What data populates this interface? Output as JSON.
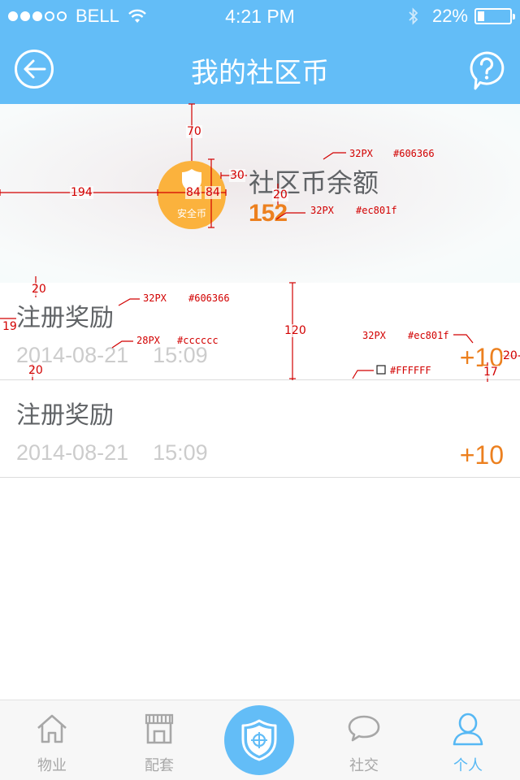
{
  "status_bar": {
    "carrier": "BELL",
    "time": "4:21 PM",
    "battery": "22%",
    "battery_level": 0.22,
    "signal_bars_filled": 3,
    "signal_bars_total": 5
  },
  "nav": {
    "title": "我的社区币",
    "back_icon": "back-arrow-icon",
    "help_icon": "question-bubble-icon"
  },
  "balance": {
    "coin_label": "安全币",
    "title": "社区币余额",
    "value": "152"
  },
  "records": [
    {
      "title": "注册奖励",
      "time": "2014-08-21    15:09",
      "amount": "+10"
    },
    {
      "title": "注册奖励",
      "time": "2014-08-21    15:09",
      "amount": "+10"
    }
  ],
  "annotations": {
    "coin_top": "70",
    "coin_left": "194",
    "coin_size_a": "84",
    "coin_size_b": "84",
    "coin_gap": "30",
    "title_gap": "20",
    "title_spec_size": "32PX",
    "title_spec_color": "#606366",
    "value_spec_size": "32PX",
    "value_spec_color": "#ec801f",
    "row_top": "20",
    "row_left": "19",
    "row_title_spec_size": "32PX",
    "row_title_spec_color": "#606366",
    "row_height": "120",
    "row_time_spec_size": "28PX",
    "row_time_spec_color": "#cccccc",
    "row_bottom": "20",
    "amount_spec_size": "32PX",
    "amount_spec_color": "#ec801f",
    "amount_right": "20",
    "amount_bottom": "17",
    "bg_spec_color": "#FFFFFF"
  },
  "tabs": [
    {
      "label": "物业",
      "icon": "house-icon",
      "active": false
    },
    {
      "label": "配套",
      "icon": "storefront-icon",
      "active": false
    },
    {
      "label": "社交",
      "icon": "chat-bubble-icon",
      "active": false
    },
    {
      "label": "个人",
      "icon": "person-icon",
      "active": true
    }
  ],
  "center_tab": {
    "icon": "shield-target-icon"
  },
  "colors": {
    "primary": "#63bdf7",
    "accent": "#ec801f",
    "text": "#606366",
    "muted": "#cccccc",
    "coin": "#fbb23d",
    "annotation": "#d20000"
  }
}
